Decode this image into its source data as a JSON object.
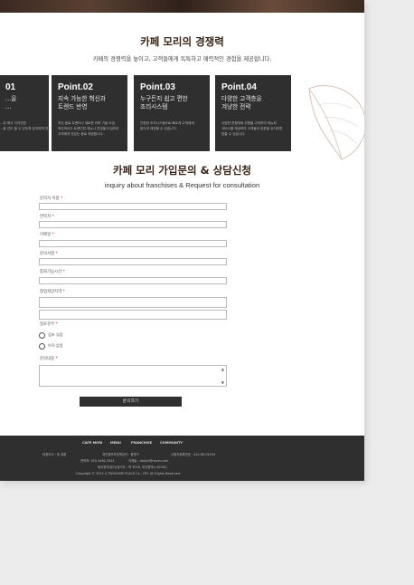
{
  "section1": {
    "title": "카페 모리의 경쟁력",
    "subtitle": "카페의 경쟁력을 높이고, 고객들에게 독특하고 매력적인 경험을 제공합니다."
  },
  "cards": [
    {
      "point": "01",
      "title": "...을\n...",
      "desc": "...취 해서 디자인한\n...을 선도 할 수 있도록 유지하며 연구하고"
    },
    {
      "point": "Point.02",
      "title": "지속 가능한 혁신과\n트렌드 반영",
      "desc": "최신 음료 트렌드나 새로운 커피 기술 도입\n혁신적이고 트렌디한 메뉴나 운영을 도입하여\n고객에게 맛있는 음료 제공합니다."
    },
    {
      "point": "Point.03",
      "title": "누구든지 쉽고 편한\n조리시스템",
      "desc": "간편한 조리시스템으로 빠르게 고객에게\n음식과 제공할 수 있습니다."
    },
    {
      "point": "Point.04",
      "title": "다양한 고객층을\n겨냥한 전략",
      "desc": "다양한 연령대와 취향을 고려하여 메뉴와\n서비스를 제공하여 고객들이 방문을 유지하면\n맞출 수 있습니다."
    }
  ],
  "form": {
    "title": "카페 모리 가입문의 & 상담신청",
    "subtitle": "inquiry about franchises & Request for consultation",
    "fields": [
      {
        "label": "문의자 이름",
        "req": "*"
      },
      {
        "label": "연락처",
        "req": "*"
      },
      {
        "label": "이메일",
        "req": "*"
      },
      {
        "label": "문의사항",
        "req": "*"
      },
      {
        "label": "통화가능시간",
        "req": "*"
      },
      {
        "label": "창업희망지역",
        "req": "*"
      }
    ],
    "store_label": "점포유무",
    "store_req": "*",
    "radio1": "점포 있음",
    "radio2": "아직 없음",
    "message_label": "문의내용",
    "message_req": "*",
    "submit_label": "문의하기"
  },
  "footer": {
    "nav": [
      "CAFE MORI",
      "MENU",
      "FRANCHISE",
      "COMMUNITY"
    ],
    "line1a": "대표이사 : 정 성환",
    "line1b": "개인정보보호책임자 : 정명구",
    "line1c": "사업자등록번호 : 414-86-01054",
    "line2a": "연락처: 010-3482-7641",
    "line2b": "이메일 : dohjin@naver.com",
    "line3": "회사위치(본사)경기도 : 목 3018, 부산광역시 82100",
    "copyright": "Copyright © 2021 A TWOSOME PLACE Co., LTD. All Rights Reserved."
  }
}
